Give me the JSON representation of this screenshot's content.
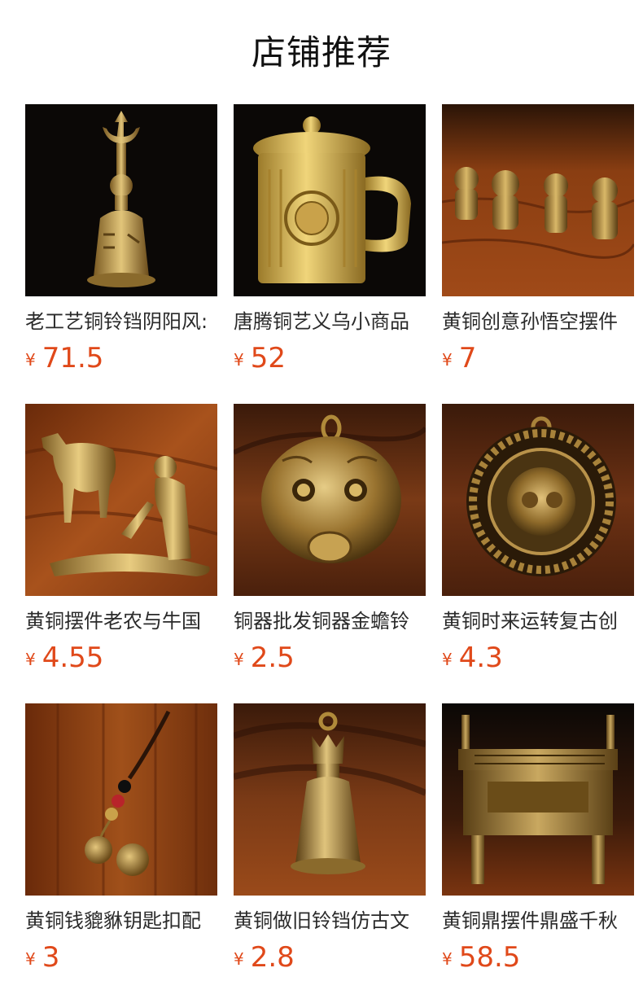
{
  "section_title": "店铺推荐",
  "currency": "¥",
  "colors": {
    "price": "#e0491a",
    "wood": "#7a3510",
    "brass": "#c9a24a",
    "dark_bg": "#0b0806"
  },
  "products": [
    {
      "name": "老工艺铜铃铛阴阳风:",
      "price": "71.5",
      "icon": "brass-bell-trident-icon"
    },
    {
      "name": "唐腾铜艺义乌小商品",
      "price": "52",
      "icon": "brass-mug-icon"
    },
    {
      "name": "黄铜创意孙悟空摆件",
      "price": "7",
      "icon": "brass-monkey-figurines-icon"
    },
    {
      "name": "黄铜摆件老农与牛国",
      "price": "4.55",
      "icon": "brass-farmer-ox-icon"
    },
    {
      "name": "铜器批发铜器金蟾铃",
      "price": "2.5",
      "icon": "brass-toad-bell-icon"
    },
    {
      "name": "黄铜时来运转复古创",
      "price": "4.3",
      "icon": "brass-round-pendant-icon"
    },
    {
      "name": "黄铜钱貔貅钥匙扣配",
      "price": "3",
      "icon": "brass-pixiu-keychain-icon"
    },
    {
      "name": "黄铜做旧铃铛仿古文",
      "price": "2.8",
      "icon": "brass-crown-bell-icon"
    },
    {
      "name": "黄铜鼎摆件鼎盛千秋",
      "price": "58.5",
      "icon": "brass-ding-cauldron-icon"
    }
  ]
}
